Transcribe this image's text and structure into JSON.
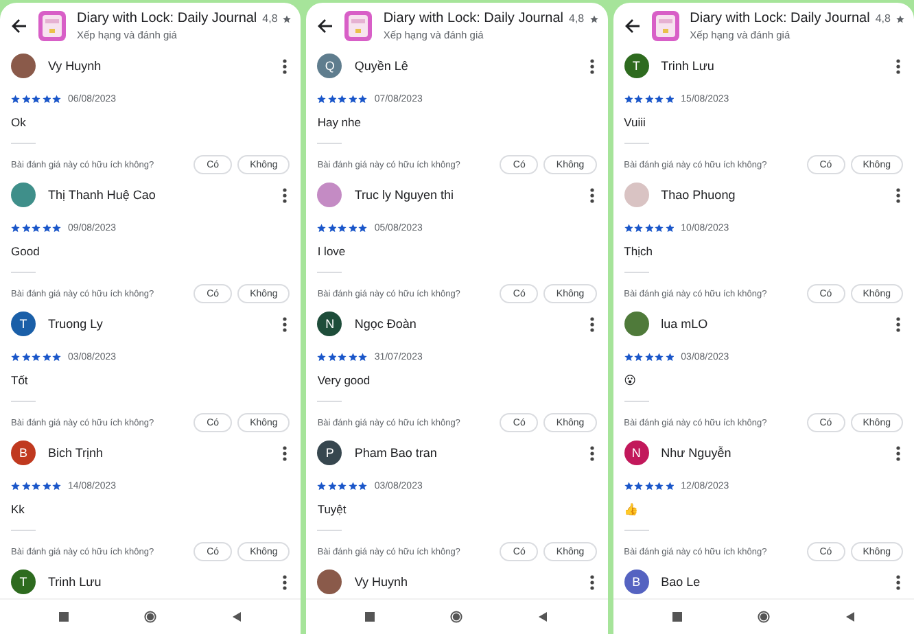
{
  "panels": [
    {
      "header": {
        "title": "Diary with Lock: Daily Journal",
        "rating": "4,8",
        "subtitle": "Xếp hạng và đánh giá"
      },
      "reviews": [
        {
          "name": "Vy Huynh",
          "avatar": {
            "kind": "photo",
            "color": "#8a5a4a"
          },
          "stars": 5,
          "date": "06/08/2023",
          "text": "Ok",
          "question": "Bài đánh giá này có hữu ích không?",
          "buttons": [
            "Có",
            "Không"
          ]
        },
        {
          "name": "Thị Thanh Huệ Cao",
          "avatar": {
            "kind": "photo",
            "color": "#3f8f8a"
          },
          "stars": 5,
          "date": "09/08/2023",
          "text": "Good",
          "question": "Bài đánh giá này có hữu ích không?",
          "buttons": [
            "Có",
            "Không"
          ]
        },
        {
          "name": "Truong Ly",
          "avatar": {
            "kind": "letter",
            "letter": "T",
            "color": "#1a5fa8"
          },
          "stars": 5,
          "date": "03/08/2023",
          "text": "Tốt",
          "question": "Bài đánh giá này có hữu ích không?",
          "buttons": [
            "Có",
            "Không"
          ]
        },
        {
          "name": "Bich Trịnh",
          "avatar": {
            "kind": "letter",
            "letter": "B",
            "color": "#c0391f"
          },
          "stars": 5,
          "date": "14/08/2023",
          "text": "Kk",
          "question": "Bài đánh giá này có hữu ích không?",
          "buttons": [
            "Có",
            "Không"
          ]
        },
        {
          "name": "Trinh Lưu",
          "avatar": {
            "kind": "letter",
            "letter": "T",
            "color": "#2e6b1f"
          }
        }
      ]
    },
    {
      "header": {
        "title": "Diary with Lock: Daily Journal",
        "rating": "4,8",
        "subtitle": "Xếp hạng và đánh giá"
      },
      "reviews": [
        {
          "name": "Quyền Lê",
          "avatar": {
            "kind": "letter",
            "letter": "Q",
            "color": "#5f7d8e"
          },
          "stars": 5,
          "date": "07/08/2023",
          "text": "Hay nhe",
          "question": "Bài đánh giá này có hữu ích không?",
          "buttons": [
            "Có",
            "Không"
          ]
        },
        {
          "name": "Truc ly Nguyen thi",
          "avatar": {
            "kind": "photo",
            "color": "#c48bc4"
          },
          "stars": 5,
          "date": "05/08/2023",
          "text": "I love",
          "question": "Bài đánh giá này có hữu ích không?",
          "buttons": [
            "Có",
            "Không"
          ]
        },
        {
          "name": "Ngọc Đoàn",
          "avatar": {
            "kind": "letter",
            "letter": "N",
            "color": "#1e4d3a"
          },
          "stars": 5,
          "date": "31/07/2023",
          "text": "Very good",
          "question": "Bài đánh giá này có hữu ích không?",
          "buttons": [
            "Có",
            "Không"
          ]
        },
        {
          "name": "Pham Bao tran",
          "avatar": {
            "kind": "letter",
            "letter": "P",
            "color": "#37474f"
          },
          "stars": 5,
          "date": "03/08/2023",
          "text": "Tuyệt",
          "question": "Bài đánh giá này có hữu ích không?",
          "buttons": [
            "Có",
            "Không"
          ]
        },
        {
          "name": "Vy Huynh",
          "avatar": {
            "kind": "photo",
            "color": "#8a5a4a"
          }
        }
      ]
    },
    {
      "header": {
        "title": "Diary with Lock: Daily Journal",
        "rating": "4,8",
        "subtitle": "Xếp hạng và đánh giá"
      },
      "reviews": [
        {
          "name": "Trinh Lưu",
          "avatar": {
            "kind": "letter",
            "letter": "T",
            "color": "#2e6b1f"
          },
          "stars": 5,
          "date": "15/08/2023",
          "text": "Vuiii",
          "question": "Bài đánh giá này có hữu ích không?",
          "buttons": [
            "Có",
            "Không"
          ]
        },
        {
          "name": "Thao Phuong",
          "avatar": {
            "kind": "photo",
            "color": "#d9c3c3"
          },
          "stars": 5,
          "date": "10/08/2023",
          "text": "Thịch",
          "question": "Bài đánh giá này có hữu ích không?",
          "buttons": [
            "Có",
            "Không"
          ]
        },
        {
          "name": "lua mLO",
          "avatar": {
            "kind": "photo",
            "color": "#4f7a3a"
          },
          "stars": 5,
          "date": "03/08/2023",
          "text": "😮",
          "question": "Bài đánh giá này có hữu ích không?",
          "buttons": [
            "Có",
            "Không"
          ]
        },
        {
          "name": "Như Nguyễn",
          "avatar": {
            "kind": "letter",
            "letter": "N",
            "color": "#c2185b"
          },
          "stars": 5,
          "date": "12/08/2023",
          "text": "👍",
          "question": "Bài đánh giá này có hữu ích không?",
          "buttons": [
            "Có",
            "Không"
          ]
        },
        {
          "name": "Bao Le",
          "avatar": {
            "kind": "letter",
            "letter": "B",
            "color": "#5563c1"
          }
        }
      ]
    }
  ]
}
